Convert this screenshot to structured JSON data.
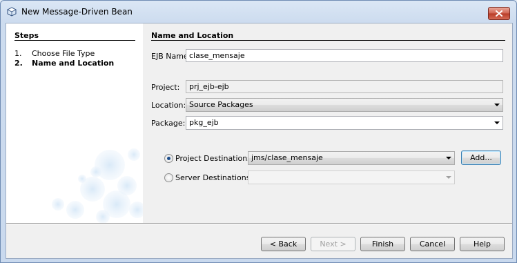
{
  "window": {
    "title": "New Message-Driven Bean",
    "icon": "netbeans-bean-icon",
    "close_icon": "close-icon"
  },
  "steps": {
    "title": "Steps",
    "items": [
      {
        "num": "1.",
        "label": "Choose File Type",
        "current": false
      },
      {
        "num": "2.",
        "label": "Name and Location",
        "current": true
      }
    ]
  },
  "form": {
    "section_title": "Name and Location",
    "ejb_name": {
      "label": "EJB Name:",
      "value": "clase_mensaje"
    },
    "project": {
      "label": "Project:",
      "value": "prj_ejb-ejb"
    },
    "location": {
      "label": "Location:",
      "value": "Source Packages"
    },
    "package": {
      "label": "Package:",
      "value": "pkg_ejb"
    },
    "project_destinations": {
      "label": "Project Destinations:",
      "value": "jms/clase_mensaje",
      "selected": true
    },
    "server_destinations": {
      "label": "Server Destinations:",
      "value": "",
      "selected": false
    },
    "add_button": "Add..."
  },
  "footer": {
    "back": "< Back",
    "next": "Next >",
    "finish": "Finish",
    "cancel": "Cancel",
    "help": "Help"
  },
  "colors": {
    "title_gradient_top": "#dbe7f5",
    "close_button": "#c94a35",
    "radio_selected": "#1b4c8a",
    "steps_background": "#ffffff"
  }
}
